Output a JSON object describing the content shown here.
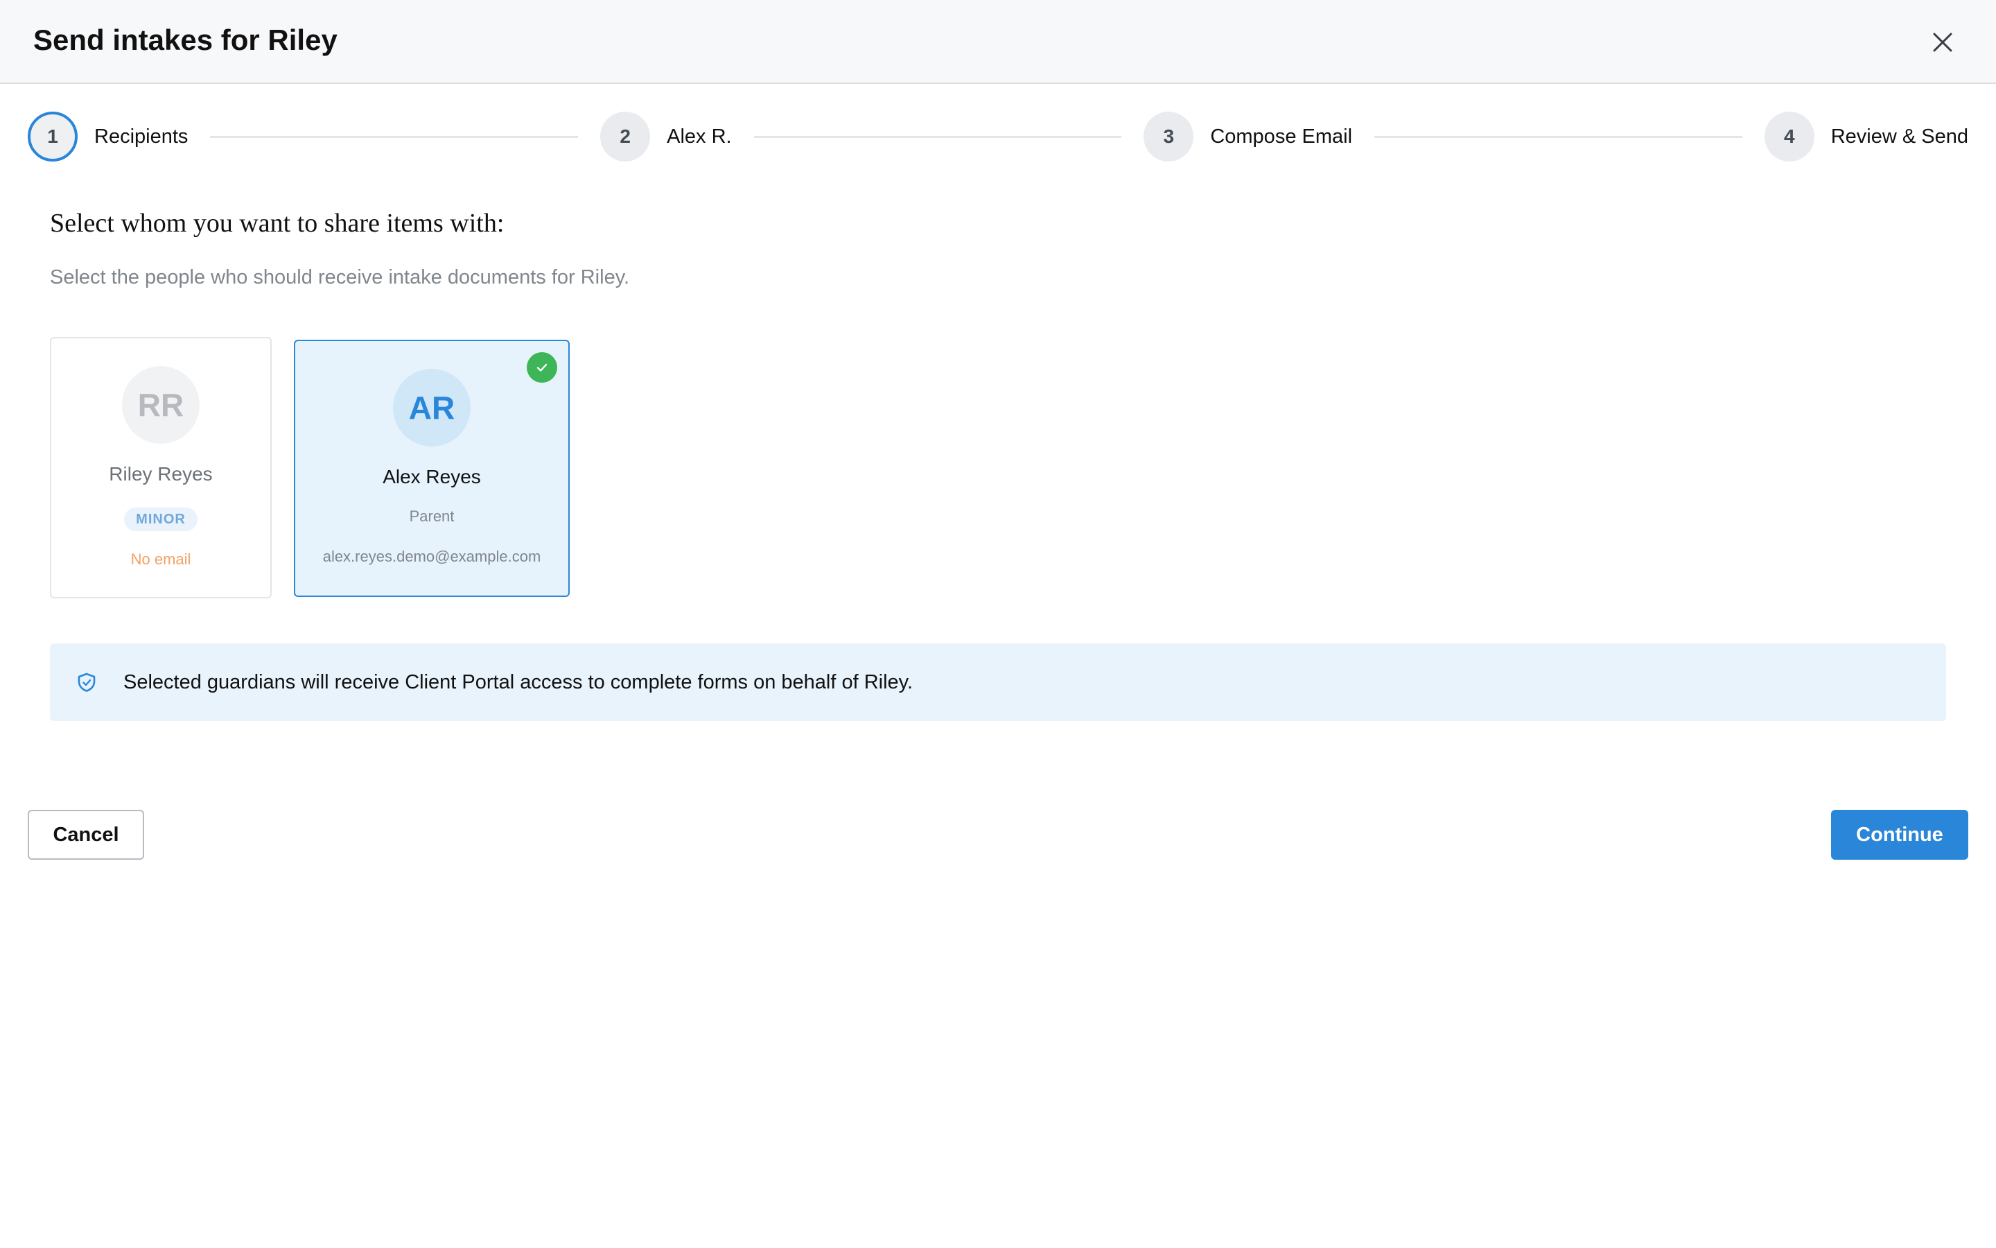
{
  "dialog": {
    "title": "Send intakes for Riley",
    "close_icon": "close-icon"
  },
  "stepper": {
    "current_step": 1,
    "steps": [
      {
        "number": "1",
        "label": "Recipients",
        "state": "active"
      },
      {
        "number": "2",
        "label": "Alex R.",
        "state": "pending"
      },
      {
        "number": "3",
        "label": "Compose Email",
        "state": "pending"
      },
      {
        "number": "4",
        "label": "Review & Send",
        "state": "pending"
      }
    ]
  },
  "main": {
    "heading": "Select whom you want to share items with:",
    "subheading": "Select the people who should receive intake documents for Riley."
  },
  "recipients": [
    {
      "initials": "RR",
      "name": "Riley Reyes",
      "badge": "MINOR",
      "email_status": "No email",
      "selected": false,
      "selectable": false
    },
    {
      "initials": "AR",
      "name": "Alex Reyes",
      "role": "Parent",
      "email": "alex.reyes.demo@example.com",
      "selected": true,
      "selectable": true,
      "check_icon": "check-circle-icon"
    }
  ],
  "info_banner": {
    "icon": "shield-icon",
    "text": "Selected guardians will receive Client Portal access to complete forms on behalf of Riley."
  },
  "footer": {
    "cancel_label": "Cancel",
    "continue_label": "Continue"
  },
  "colors": {
    "accent": "#2a86d9",
    "success": "#3db558",
    "warning_text": "#f3a066",
    "banner_bg": "#e9f3fb",
    "selected_card_bg": "#e6f3fc"
  }
}
